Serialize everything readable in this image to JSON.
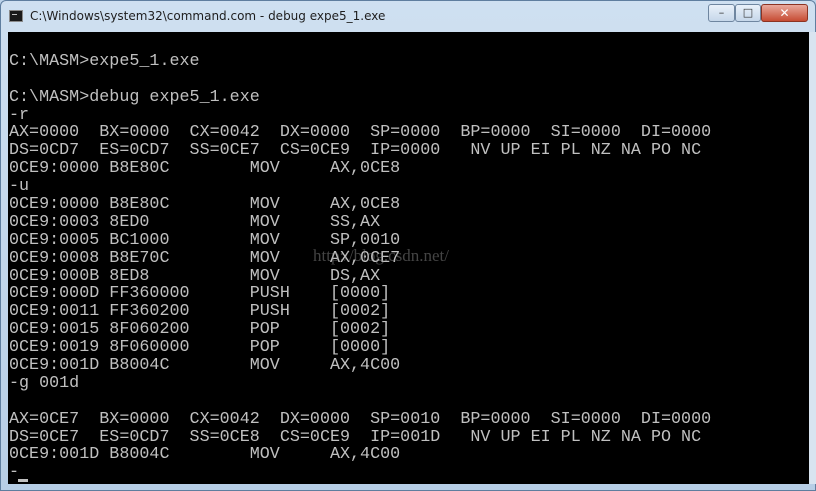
{
  "window": {
    "title": "C:\\Windows\\system32\\command.com - debug expe5_1.exe",
    "minimize_glyph": "–",
    "maximize_glyph": "□",
    "close_glyph": "✕"
  },
  "console": {
    "lines": [
      "",
      "C:\\MASM>expe5_1.exe",
      "",
      "C:\\MASM>debug expe5_1.exe",
      "-r",
      "AX=0000  BX=0000  CX=0042  DX=0000  SP=0000  BP=0000  SI=0000  DI=0000",
      "DS=0CD7  ES=0CD7  SS=0CE7  CS=0CE9  IP=0000   NV UP EI PL NZ NA PO NC",
      "0CE9:0000 B8E80C        MOV     AX,0CE8",
      "-u",
      "0CE9:0000 B8E80C        MOV     AX,0CE8",
      "0CE9:0003 8ED0          MOV     SS,AX",
      "0CE9:0005 BC1000        MOV     SP,0010",
      "0CE9:0008 B8E70C        MOV     AX,0CE7",
      "0CE9:000B 8ED8          MOV     DS,AX",
      "0CE9:000D FF360000      PUSH    [0000]",
      "0CE9:0011 FF360200      PUSH    [0002]",
      "0CE9:0015 8F060200      POP     [0002]",
      "0CE9:0019 8F060000      POP     [0000]",
      "0CE9:001D B8004C        MOV     AX,4C00",
      "-g 001d",
      "",
      "AX=0CE7  BX=0000  CX=0042  DX=0000  SP=0010  BP=0000  SI=0000  DI=0000",
      "DS=0CE7  ES=0CD7  SS=0CE8  CS=0CE9  IP=001D   NV UP EI PL NZ NA PO NC",
      "0CE9:001D B8004C        MOV     AX,4C00",
      "-"
    ],
    "watermark": "http://blog.csdn.net/"
  },
  "colors": {
    "console_bg": "#000000",
    "console_fg": "#c0c0c0",
    "titlebar": "#c4d8ec",
    "close_button": "#c64c33"
  },
  "icons": {
    "app": "command-prompt-icon",
    "minimize": "minimize-icon",
    "maximize": "maximize-icon",
    "close": "close-icon"
  }
}
